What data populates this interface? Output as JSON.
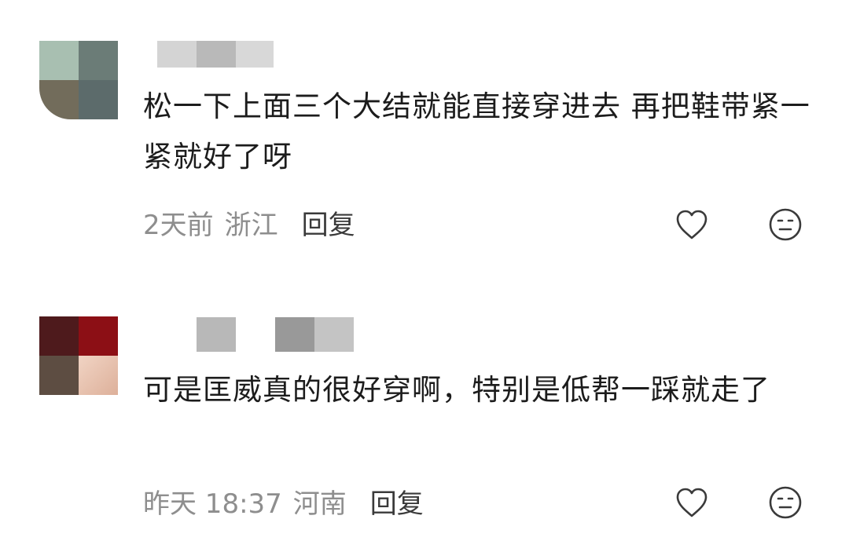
{
  "comments": [
    {
      "avatar_colors": [
        "#a8bfb1",
        "#6b7c77",
        "#726c5b",
        "#5c6b6b"
      ],
      "username_blocks": [
        "#d4d4d4",
        "#b9b9b9",
        "#d8d8d8"
      ],
      "text": "松一下上面三个大结就能直接穿进去 再把鞋带紧一紧就好了呀",
      "time": "2天前",
      "location": "浙江",
      "reply_label": "回复",
      "like_icon": "heart-outline-icon",
      "dislike_icon": "neutral-face-icon"
    },
    {
      "avatar_colors": [
        "#4e1a1c",
        "#8c0f15",
        "#5d4d42",
        "#e9c6b4"
      ],
      "username_blocks": [
        "#ffffff",
        "#b8b8b8",
        "#ffffff",
        "#999999",
        "#c4c4c4"
      ],
      "text": "可是匡威真的很好穿啊，特别是低帮一踩就走了",
      "time": "昨天 18:37",
      "location": "河南",
      "reply_label": "回复",
      "like_icon": "heart-outline-icon",
      "dislike_icon": "neutral-face-icon"
    }
  ],
  "colors": {
    "text": "#1c1c1c",
    "meta": "#8e8e8e",
    "reply": "#3a3a3a",
    "icon": "#3a3a3a"
  }
}
